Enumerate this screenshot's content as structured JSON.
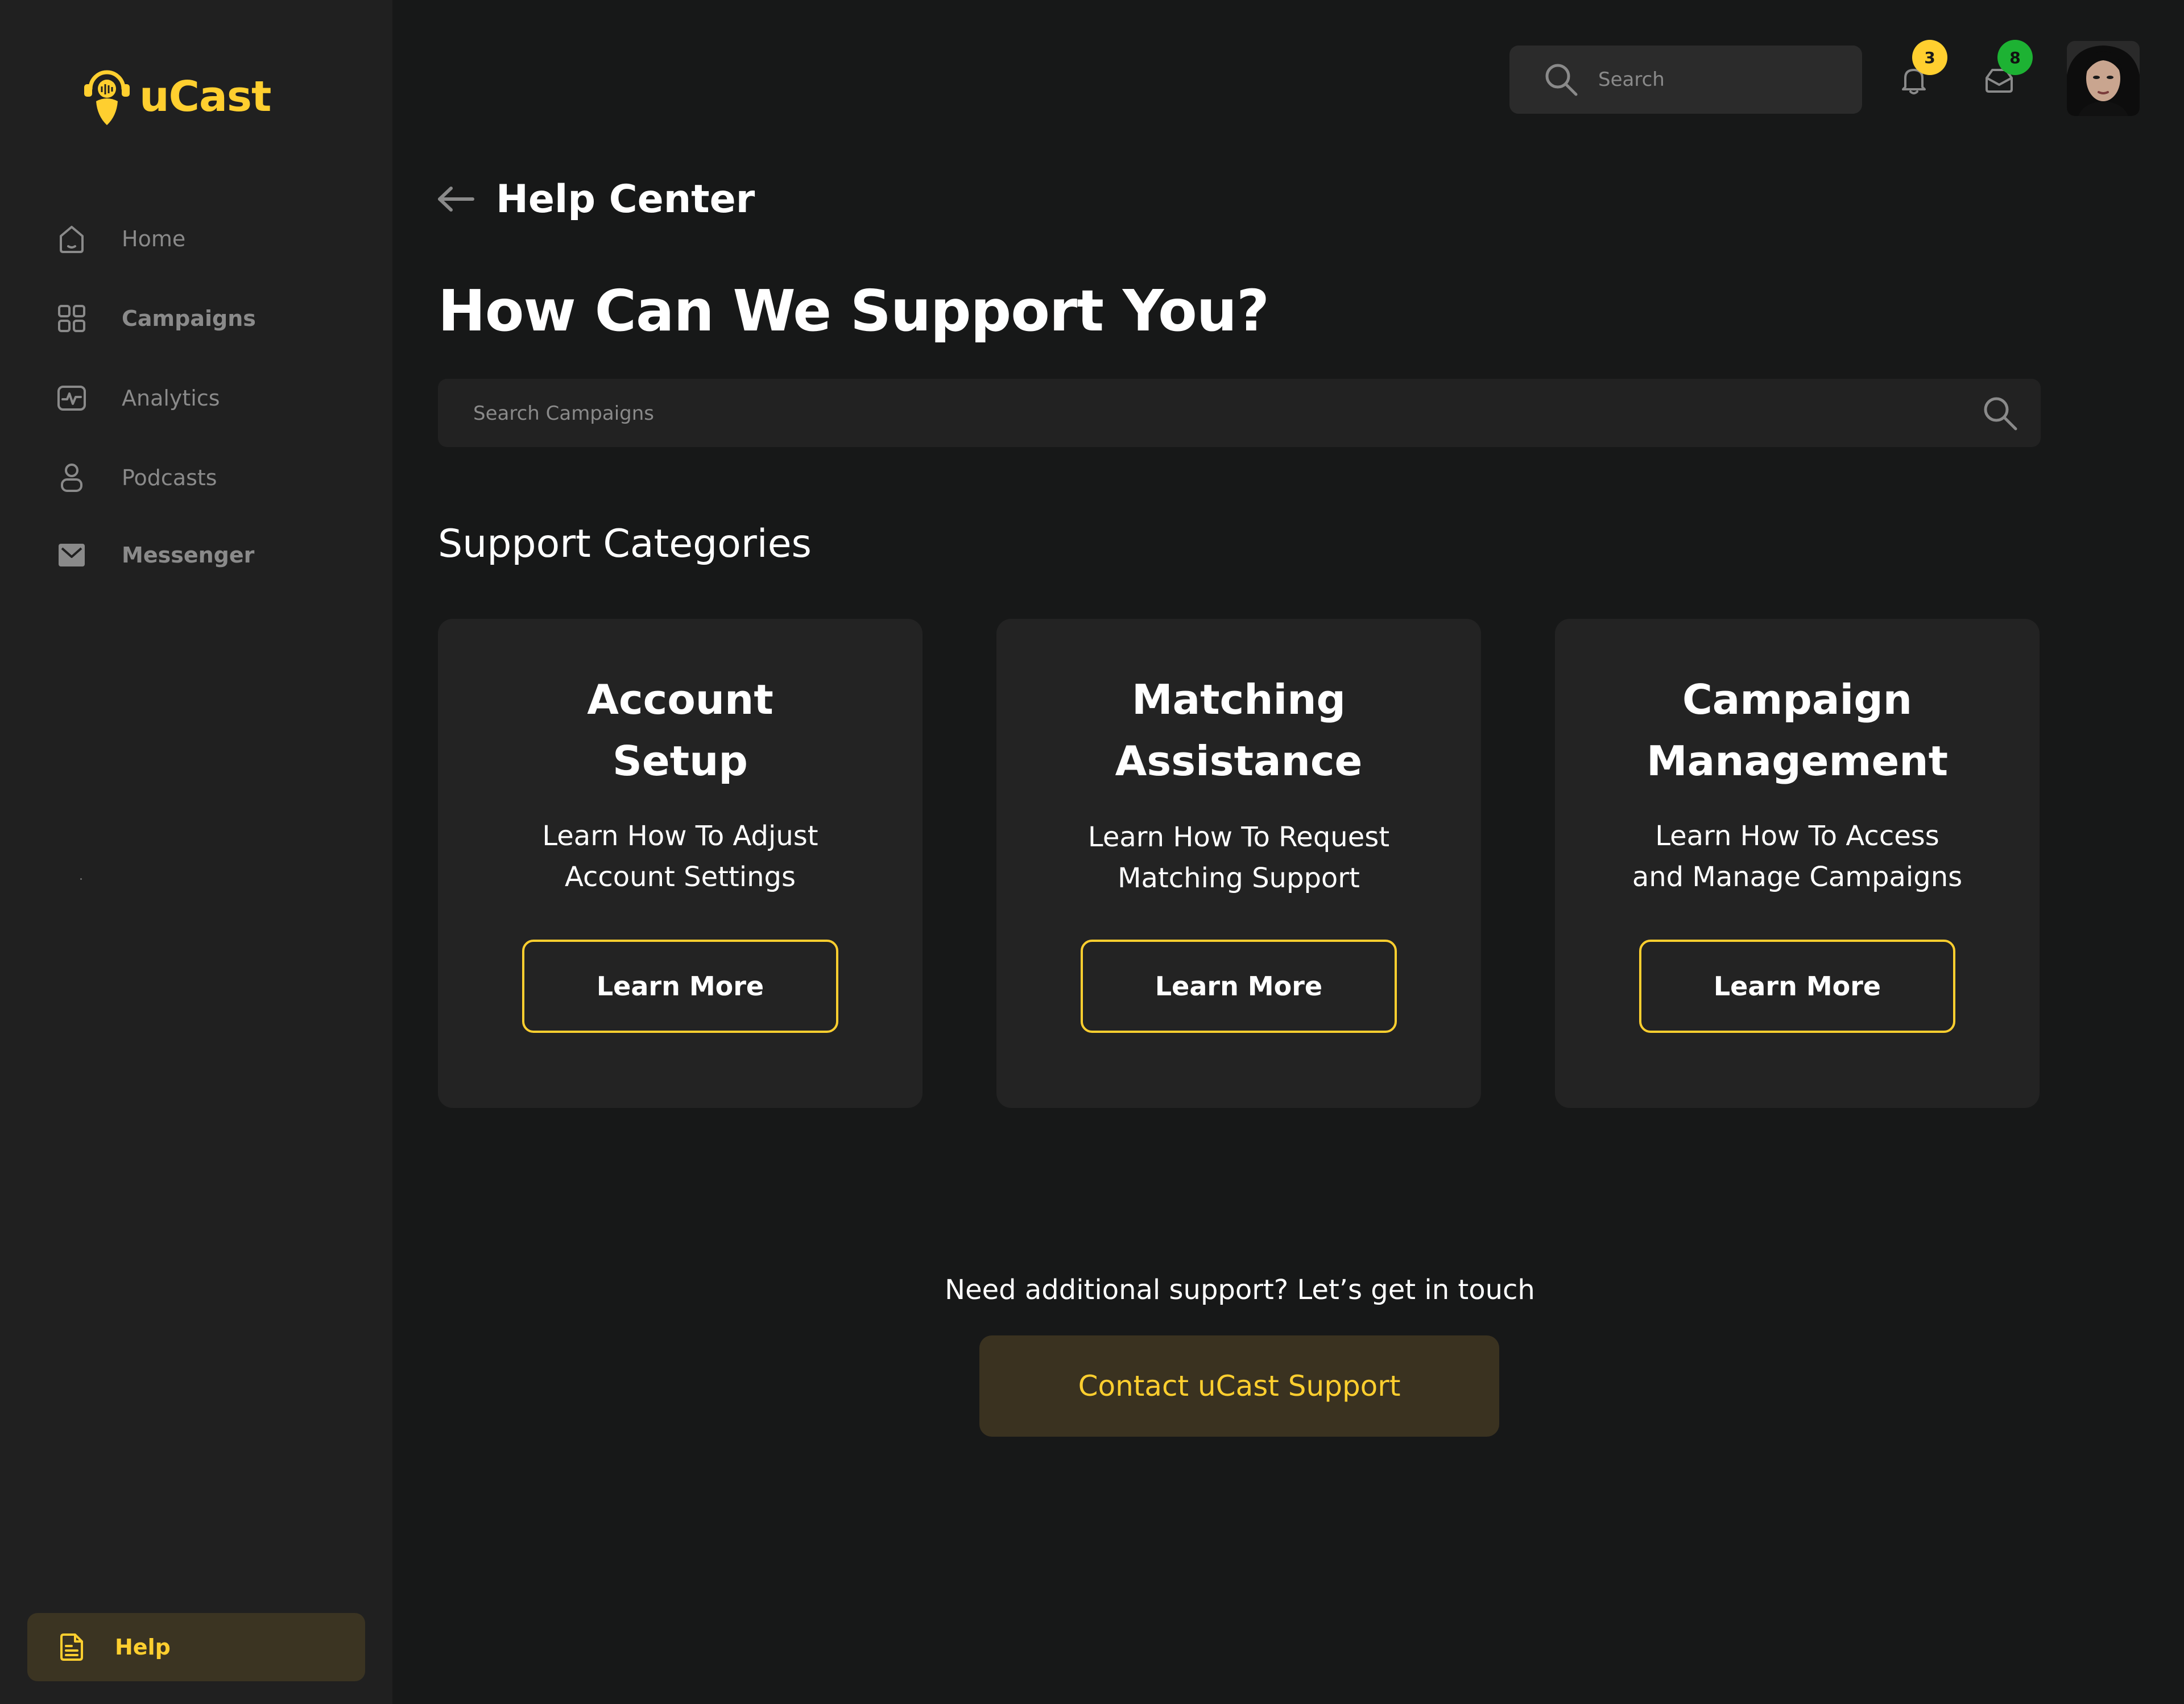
{
  "app": {
    "name": "uCast",
    "accent_color": "#FFCF2F"
  },
  "sidebar": {
    "items": [
      {
        "label": "Home",
        "icon": "home-icon"
      },
      {
        "label": "Campaigns",
        "icon": "grid-icon"
      },
      {
        "label": "Analytics",
        "icon": "analytics-icon"
      },
      {
        "label": "Podcasts",
        "icon": "user-icon"
      },
      {
        "label": "Messenger",
        "icon": "mail-icon"
      }
    ],
    "help": {
      "label": "Help",
      "icon": "document-icon"
    }
  },
  "topbar": {
    "search_placeholder": "Search",
    "notifications_count": "3",
    "notifications_badge_color": "#FFCF2F",
    "messages_count": "8",
    "messages_badge_color": "#1DB233"
  },
  "page": {
    "breadcrumb": "Help Center",
    "heading": "How Can We Support You?",
    "search_placeholder": "Search Campaigns",
    "section_title": "Support Categories"
  },
  "categories": [
    {
      "title_line1": "Account",
      "title_line2": "Setup",
      "desc_line1": "Learn How To Adjust",
      "desc_line2": "Account Settings",
      "button": "Learn More"
    },
    {
      "title_line1": "Matching",
      "title_line2": "Assistance",
      "desc_line1": "Learn How To Request",
      "desc_line2": "Matching Support",
      "button": "Learn More"
    },
    {
      "title_line1": "Campaign",
      "title_line2": "Management",
      "desc_line1": "Learn How To Access",
      "desc_line2": "and Manage Campaigns",
      "button": "Learn More"
    }
  ],
  "support": {
    "text": "Need additional support? Let’s get in touch",
    "button": "Contact uCast Support"
  }
}
